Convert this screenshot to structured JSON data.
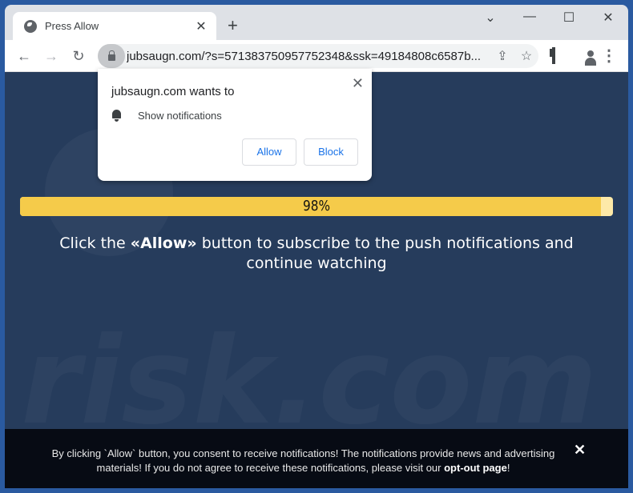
{
  "browser": {
    "tab": {
      "title": "Press Allow",
      "favicon": "globe-icon",
      "close_glyph": "✕"
    },
    "new_tab_glyph": "+",
    "window_controls": {
      "tab_search": "⌄",
      "minimize": "—",
      "maximize": "☐",
      "close": "✕"
    },
    "nav": {
      "back": "←",
      "forward": "→",
      "reload": "↻"
    },
    "url": "jubsaugn.com/?s=571383750957752348&ssk=49184808c6587b...",
    "toolbar_icons": {
      "share": "⇪",
      "bookmark": "☆",
      "menu": "⋮"
    }
  },
  "permission_popup": {
    "title": "jubsaugn.com wants to",
    "permission": "Show notifications",
    "close_glyph": "✕",
    "allow_label": "Allow",
    "block_label": "Block"
  },
  "page": {
    "progress": {
      "percent": 98,
      "label": "98%"
    },
    "headline_before": "Click the ",
    "headline_bold": "«Allow»",
    "headline_after": " button to subscribe to the push notifications and continue watching",
    "watermark": "risk.com",
    "colors": {
      "background": "#263c5c",
      "progress_fill": "#f5cb4a",
      "progress_track": "#fde9a8"
    }
  },
  "footer": {
    "text_before": "By clicking `Allow` button, you consent to receive notifications! The notifications provide news and advertising materials! If you do not agree to receive these notifications, please visit our ",
    "link_label": "opt-out page",
    "text_after": "!",
    "close_glyph": "✕"
  }
}
